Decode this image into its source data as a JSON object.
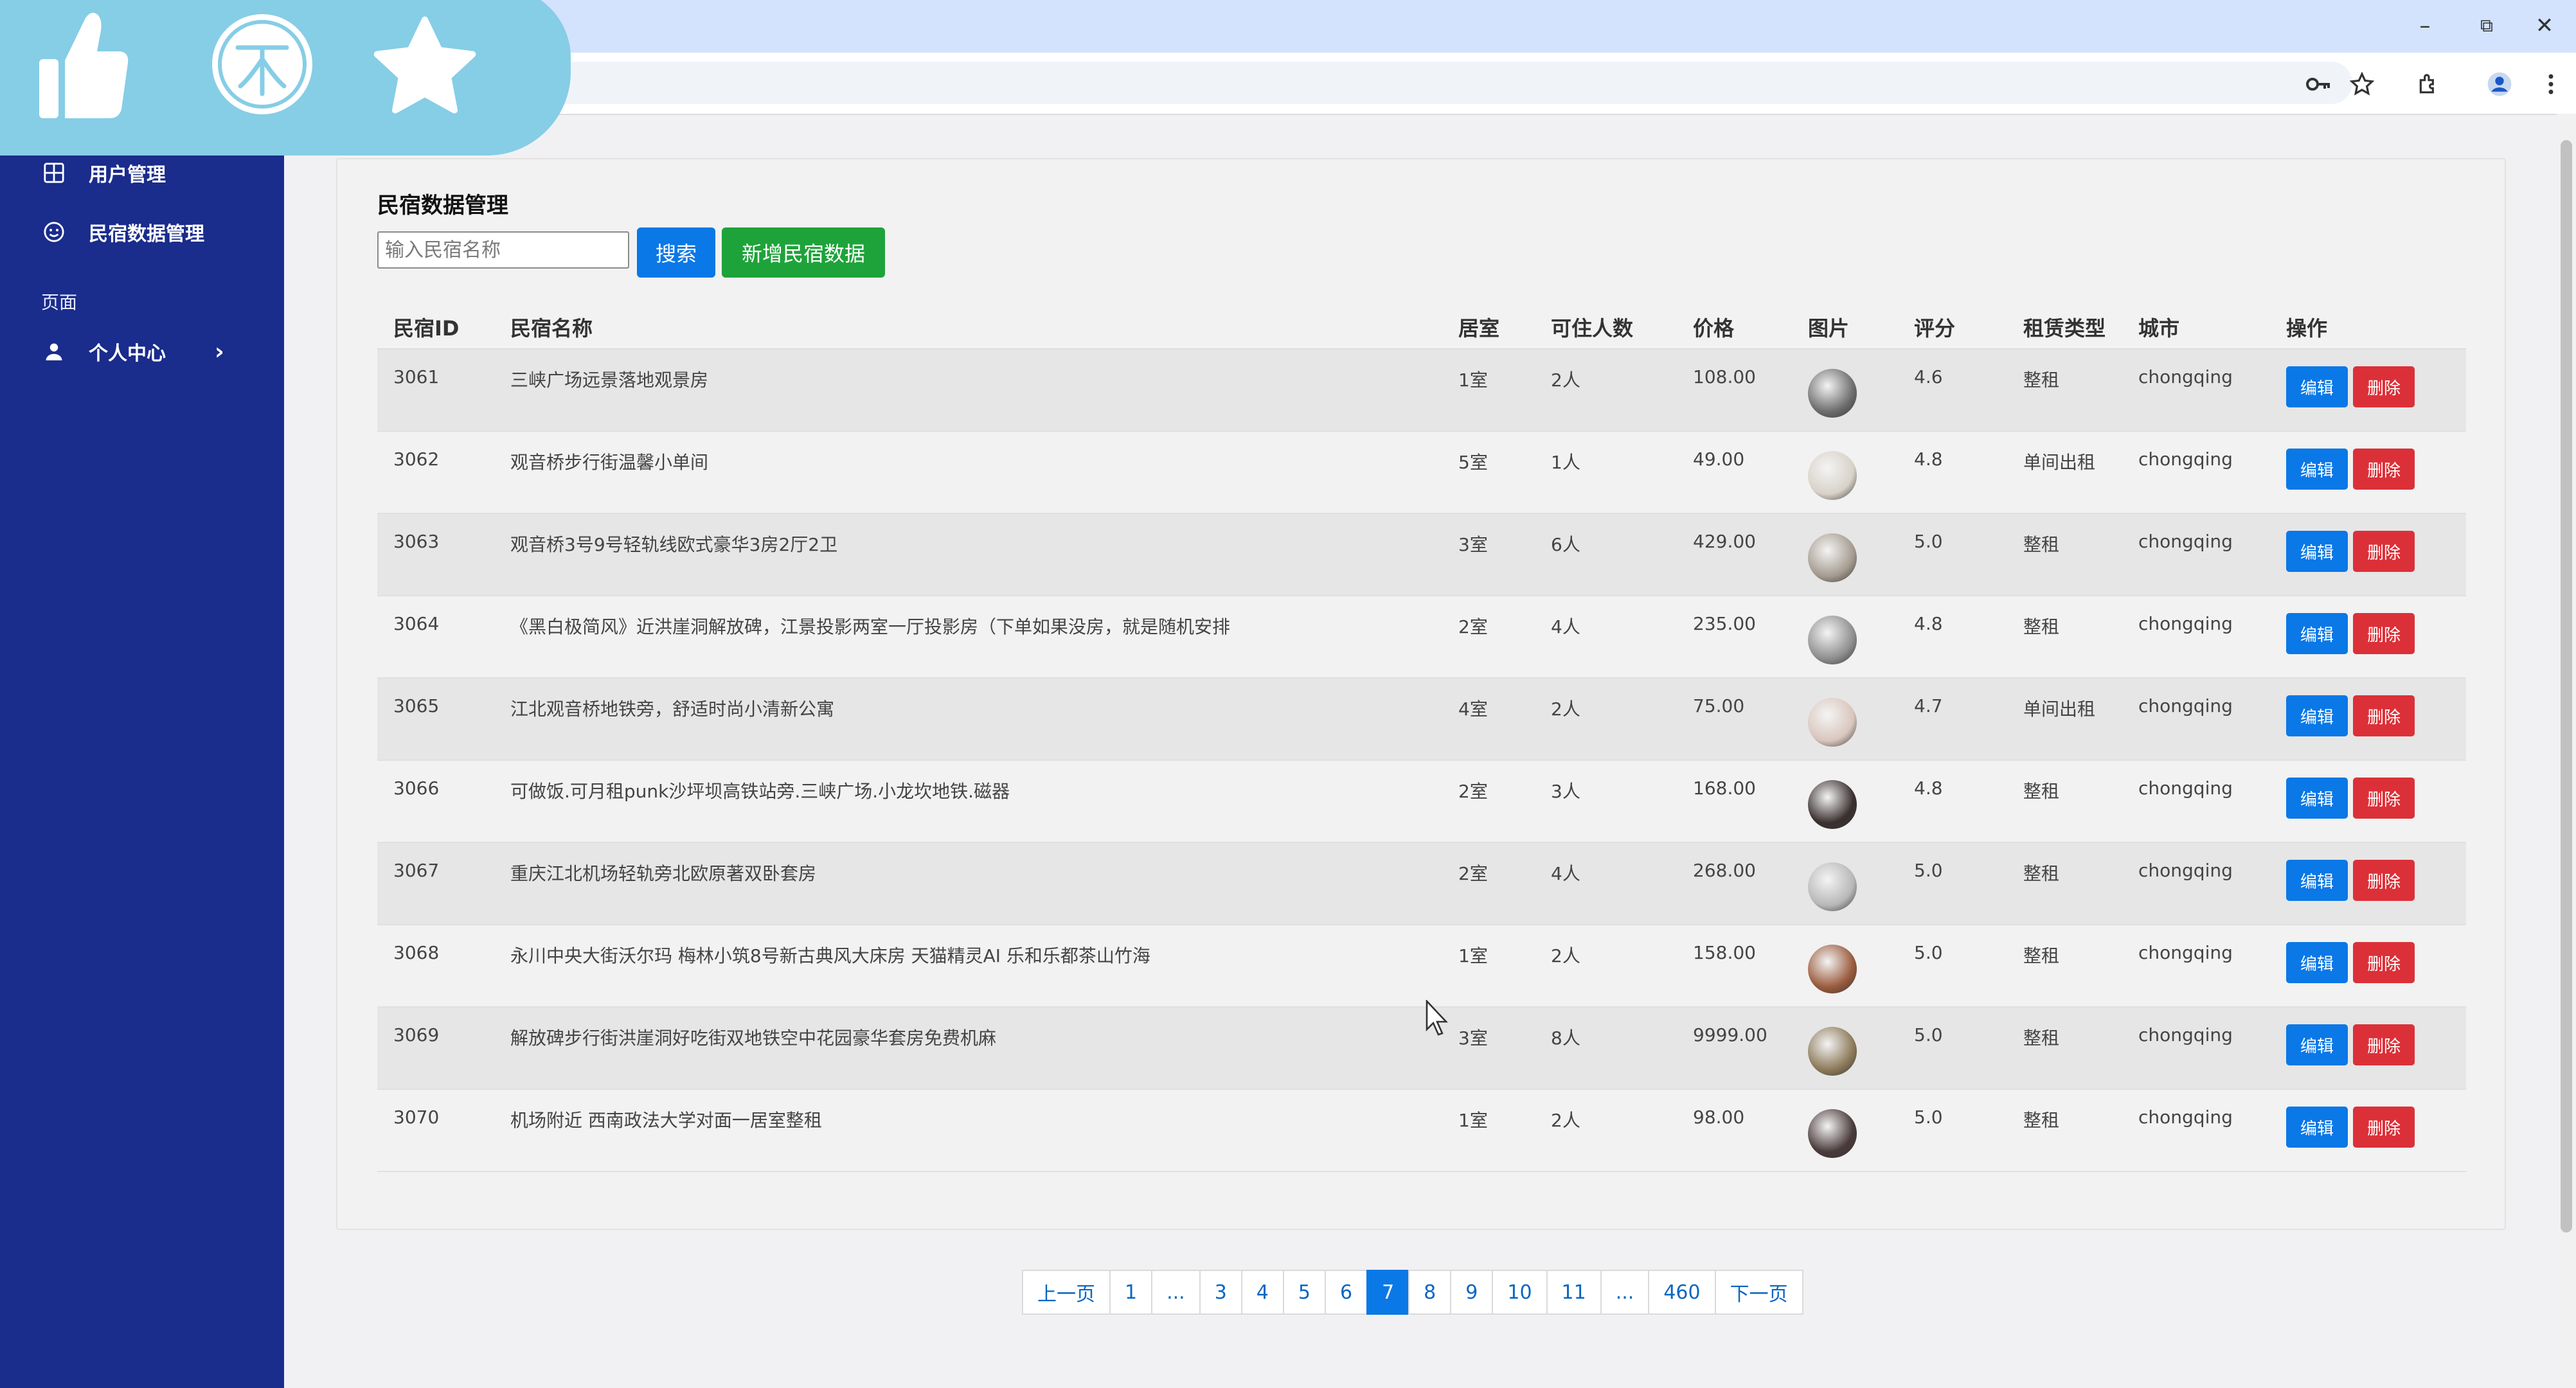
{
  "browser": {
    "window_controls": {
      "minimize": "–",
      "restore": "⧉",
      "close": "✕"
    },
    "toolbar_icons": [
      "key-icon",
      "bookmark-star-icon",
      "extensions-icon",
      "profile-icon",
      "menu-icon"
    ]
  },
  "overlay": {
    "icons": [
      "thumbs-up-icon",
      "coin-icon",
      "star-icon"
    ],
    "color": "#86cde6"
  },
  "sidebar": {
    "bg_color": "#1a2c8c",
    "items": [
      {
        "label": "用户管理",
        "icon": "grid-icon"
      },
      {
        "label": "民宿数据管理",
        "icon": "smile-icon"
      }
    ],
    "section_label": "页面",
    "profile_item": {
      "label": "个人中心",
      "icon": "user-icon",
      "chevron": "›"
    }
  },
  "main": {
    "title": "民宿数据管理",
    "search": {
      "placeholder": "输入民宿名称",
      "value": ""
    },
    "search_button": "搜索",
    "add_button": "新增民宿数据",
    "table": {
      "columns": [
        "民宿ID",
        "民宿名称",
        "居室",
        "可住人数",
        "价格",
        "图片",
        "评分",
        "租赁类型",
        "城市",
        "操作"
      ],
      "edit_label": "编辑",
      "delete_label": "删除",
      "rows": [
        {
          "id": "3061",
          "name": "三峡广场远景落地观景房",
          "rooms": "1室",
          "capacity": "2人",
          "price": "108.00",
          "rating": "4.6",
          "rent_type": "整租",
          "city": "chongqing"
        },
        {
          "id": "3062",
          "name": "观音桥步行街温馨小单间",
          "rooms": "5室",
          "capacity": "1人",
          "price": "49.00",
          "rating": "4.8",
          "rent_type": "单间出租",
          "city": "chongqing"
        },
        {
          "id": "3063",
          "name": "观音桥3号9号轻轨线欧式豪华3房2厅2卫",
          "rooms": "3室",
          "capacity": "6人",
          "price": "429.00",
          "rating": "5.0",
          "rent_type": "整租",
          "city": "chongqing"
        },
        {
          "id": "3064",
          "name": "《黑白极简风》近洪崖洞解放碑，江景投影两室一厅投影房（下单如果没房，就是随机安排",
          "rooms": "2室",
          "capacity": "4人",
          "price": "235.00",
          "rating": "4.8",
          "rent_type": "整租",
          "city": "chongqing"
        },
        {
          "id": "3065",
          "name": "江北观音桥地铁旁，舒适时尚小清新公寓",
          "rooms": "4室",
          "capacity": "2人",
          "price": "75.00",
          "rating": "4.7",
          "rent_type": "单间出租",
          "city": "chongqing"
        },
        {
          "id": "3066",
          "name": "可做饭.可月租punk沙坪坝高铁站旁.三峡广场.小龙坎地铁.磁器",
          "rooms": "2室",
          "capacity": "3人",
          "price": "168.00",
          "rating": "4.8",
          "rent_type": "整租",
          "city": "chongqing"
        },
        {
          "id": "3067",
          "name": "重庆江北机场轻轨旁北欧原著双卧套房",
          "rooms": "2室",
          "capacity": "4人",
          "price": "268.00",
          "rating": "5.0",
          "rent_type": "整租",
          "city": "chongqing"
        },
        {
          "id": "3068",
          "name": "永川中央大街沃尔玛 梅林小筑8号新古典风大床房 天猫精灵AI 乐和乐都茶山竹海",
          "rooms": "1室",
          "capacity": "2人",
          "price": "158.00",
          "rating": "5.0",
          "rent_type": "整租",
          "city": "chongqing"
        },
        {
          "id": "3069",
          "name": "解放碑步行街洪崖洞好吃街双地铁空中花园豪华套房免费机麻",
          "rooms": "3室",
          "capacity": "8人",
          "price": "9999.00",
          "rating": "5.0",
          "rent_type": "整租",
          "city": "chongqing"
        },
        {
          "id": "3070",
          "name": "机场附近 西南政法大学对面一居室整租",
          "rooms": "1室",
          "capacity": "2人",
          "price": "98.00",
          "rating": "5.0",
          "rent_type": "整租",
          "city": "chongqing"
        }
      ],
      "thumb_colors": [
        "#6d6d6d",
        "#d8d2c8",
        "#a59c90",
        "#8f8f8f",
        "#d9c6bd",
        "#3b3030",
        "#b8b8b8",
        "#9a5a3c",
        "#8d7a5a",
        "#4a3a3a"
      ]
    },
    "pagination": {
      "prev": "上一页",
      "next": "下一页",
      "pages": [
        "1",
        "...",
        "3",
        "4",
        "5",
        "6",
        "7",
        "8",
        "9",
        "10",
        "11",
        "...",
        "460"
      ],
      "current": "7"
    }
  },
  "colors": {
    "primary": "#0a78e6",
    "success": "#1ea33a",
    "danger": "#dc3038"
  }
}
